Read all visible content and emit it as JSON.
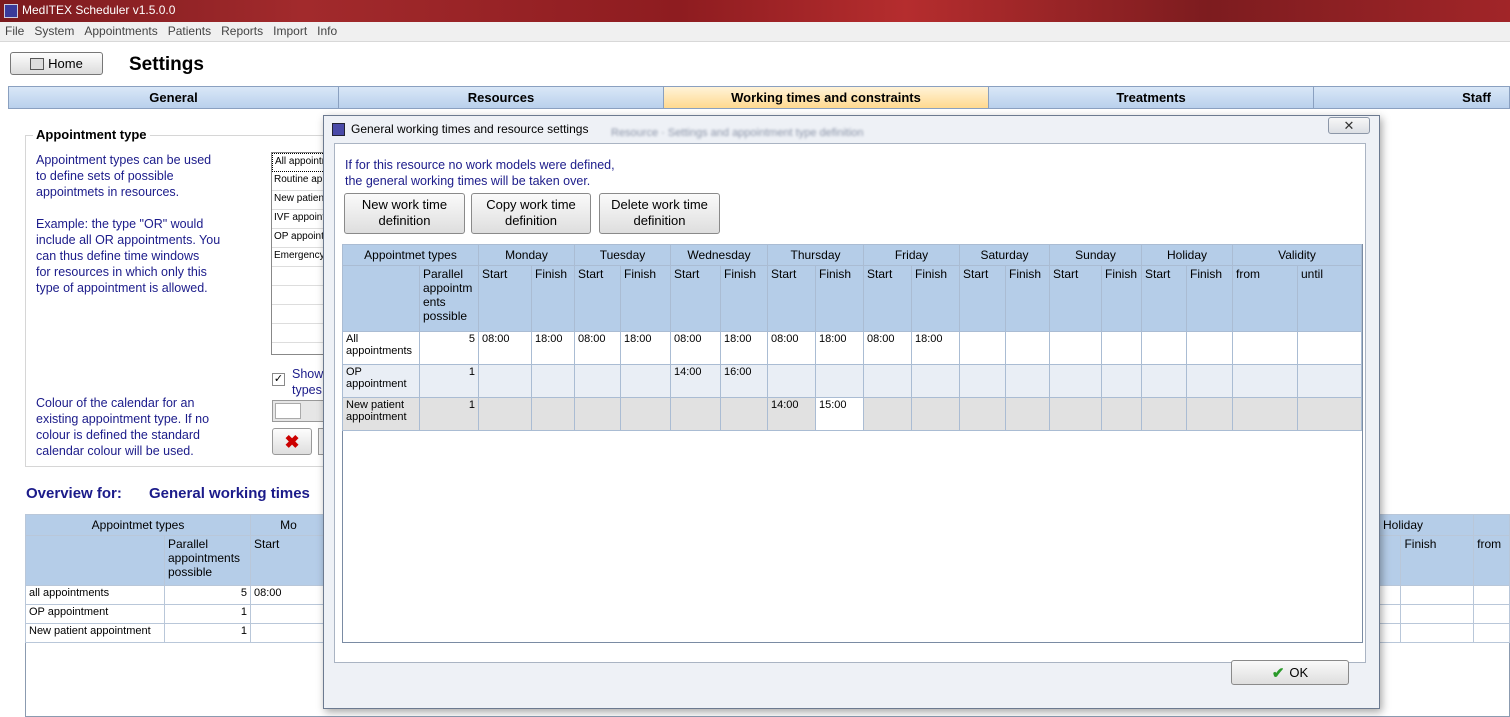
{
  "window": {
    "title": "MedITEX  Scheduler v1.5.0.0"
  },
  "menu": [
    "File",
    "System",
    "Appointments",
    "Patients",
    "Reports",
    "Import",
    "Info"
  ],
  "toolbar": {
    "home_label": "Home",
    "page_title": "Settings"
  },
  "tabs": [
    "General",
    "Resources",
    "Working times and constraints",
    "Treatments",
    "Staff"
  ],
  "appointment_type": {
    "group_title": "Appointment type",
    "description1": "Appointment types can be used\nto define sets of possible\nappointmets in resources.",
    "description2": "Example: the type \"OR\" would\ninclude all OR appointments. You\ncan thus define time windows\nfor resources in which only this\ntype of appointment is allowed.",
    "colour_text": "Colour of the calendar for an\nexisting appointment type. If no\ncolour is defined the standard\ncalendar colour will be used.",
    "list_items": [
      "All appointments",
      "Routine appointment",
      "New patient appointment",
      "IVF appointment",
      "OP appointment",
      "Emergency"
    ],
    "show_label": "Show\ntypes",
    "show_checked": "✓"
  },
  "overview": {
    "label": "Overview for:",
    "value": "General working times",
    "header": {
      "types": "Appointmet types",
      "monday_partial": "Mo",
      "holiday": "Holiday",
      "parallel": "Parallel\nappointments\npossible",
      "start": "Start",
      "finish": "Finish",
      "from": "from"
    },
    "rows": [
      {
        "name": "all appointments",
        "parallel": "5",
        "start": "08:00"
      },
      {
        "name": "OP appointment",
        "parallel": "1",
        "start": ""
      },
      {
        "name": "New patient appointment",
        "parallel": "1",
        "start": ""
      }
    ]
  },
  "dialog": {
    "title": "General working times and resource settings",
    "blurred_text": "Resource · Settings and appointment type definition",
    "close_label": "✕",
    "info": "If for this resource no work models were defined,\nthe general working times will be taken over.",
    "buttons": {
      "new": "New work time\ndefinition",
      "copy": "Copy work time\ndefinition",
      "delete": "Delete work time\ndefinition"
    },
    "ok_label": "OK",
    "grid": {
      "header_types": "Appointmet types",
      "days": [
        "Monday",
        "Tuesday",
        "Wednesday",
        "Thursday",
        "Friday",
        "Saturday",
        "Sunday",
        "Holiday"
      ],
      "validity": "Validity",
      "parallel": "Parallel\nappointm\nents\npossible",
      "start": "Start",
      "finish": "Finish",
      "from": "from",
      "until": "until",
      "rows": [
        {
          "name": "All\nappointments",
          "parallel": "5",
          "times": [
            "08:00",
            "18:00",
            "08:00",
            "18:00",
            "08:00",
            "18:00",
            "08:00",
            "18:00",
            "08:00",
            "18:00",
            "",
            "",
            "",
            "",
            "",
            ""
          ],
          "from": "",
          "until": ""
        },
        {
          "name": "OP\nappointment",
          "parallel": "1",
          "times": [
            "",
            "",
            "",
            "",
            "14:00",
            "16:00",
            "",
            "",
            "",
            "",
            "",
            "",
            "",
            "",
            "",
            ""
          ],
          "from": "",
          "until": ""
        },
        {
          "name": "New patient\nappointment",
          "parallel": "1",
          "times": [
            "",
            "",
            "",
            "",
            "",
            "",
            "14:00",
            "15:00",
            "",
            "",
            "",
            "",
            "",
            "",
            "",
            ""
          ],
          "from": "",
          "until": ""
        }
      ]
    }
  }
}
